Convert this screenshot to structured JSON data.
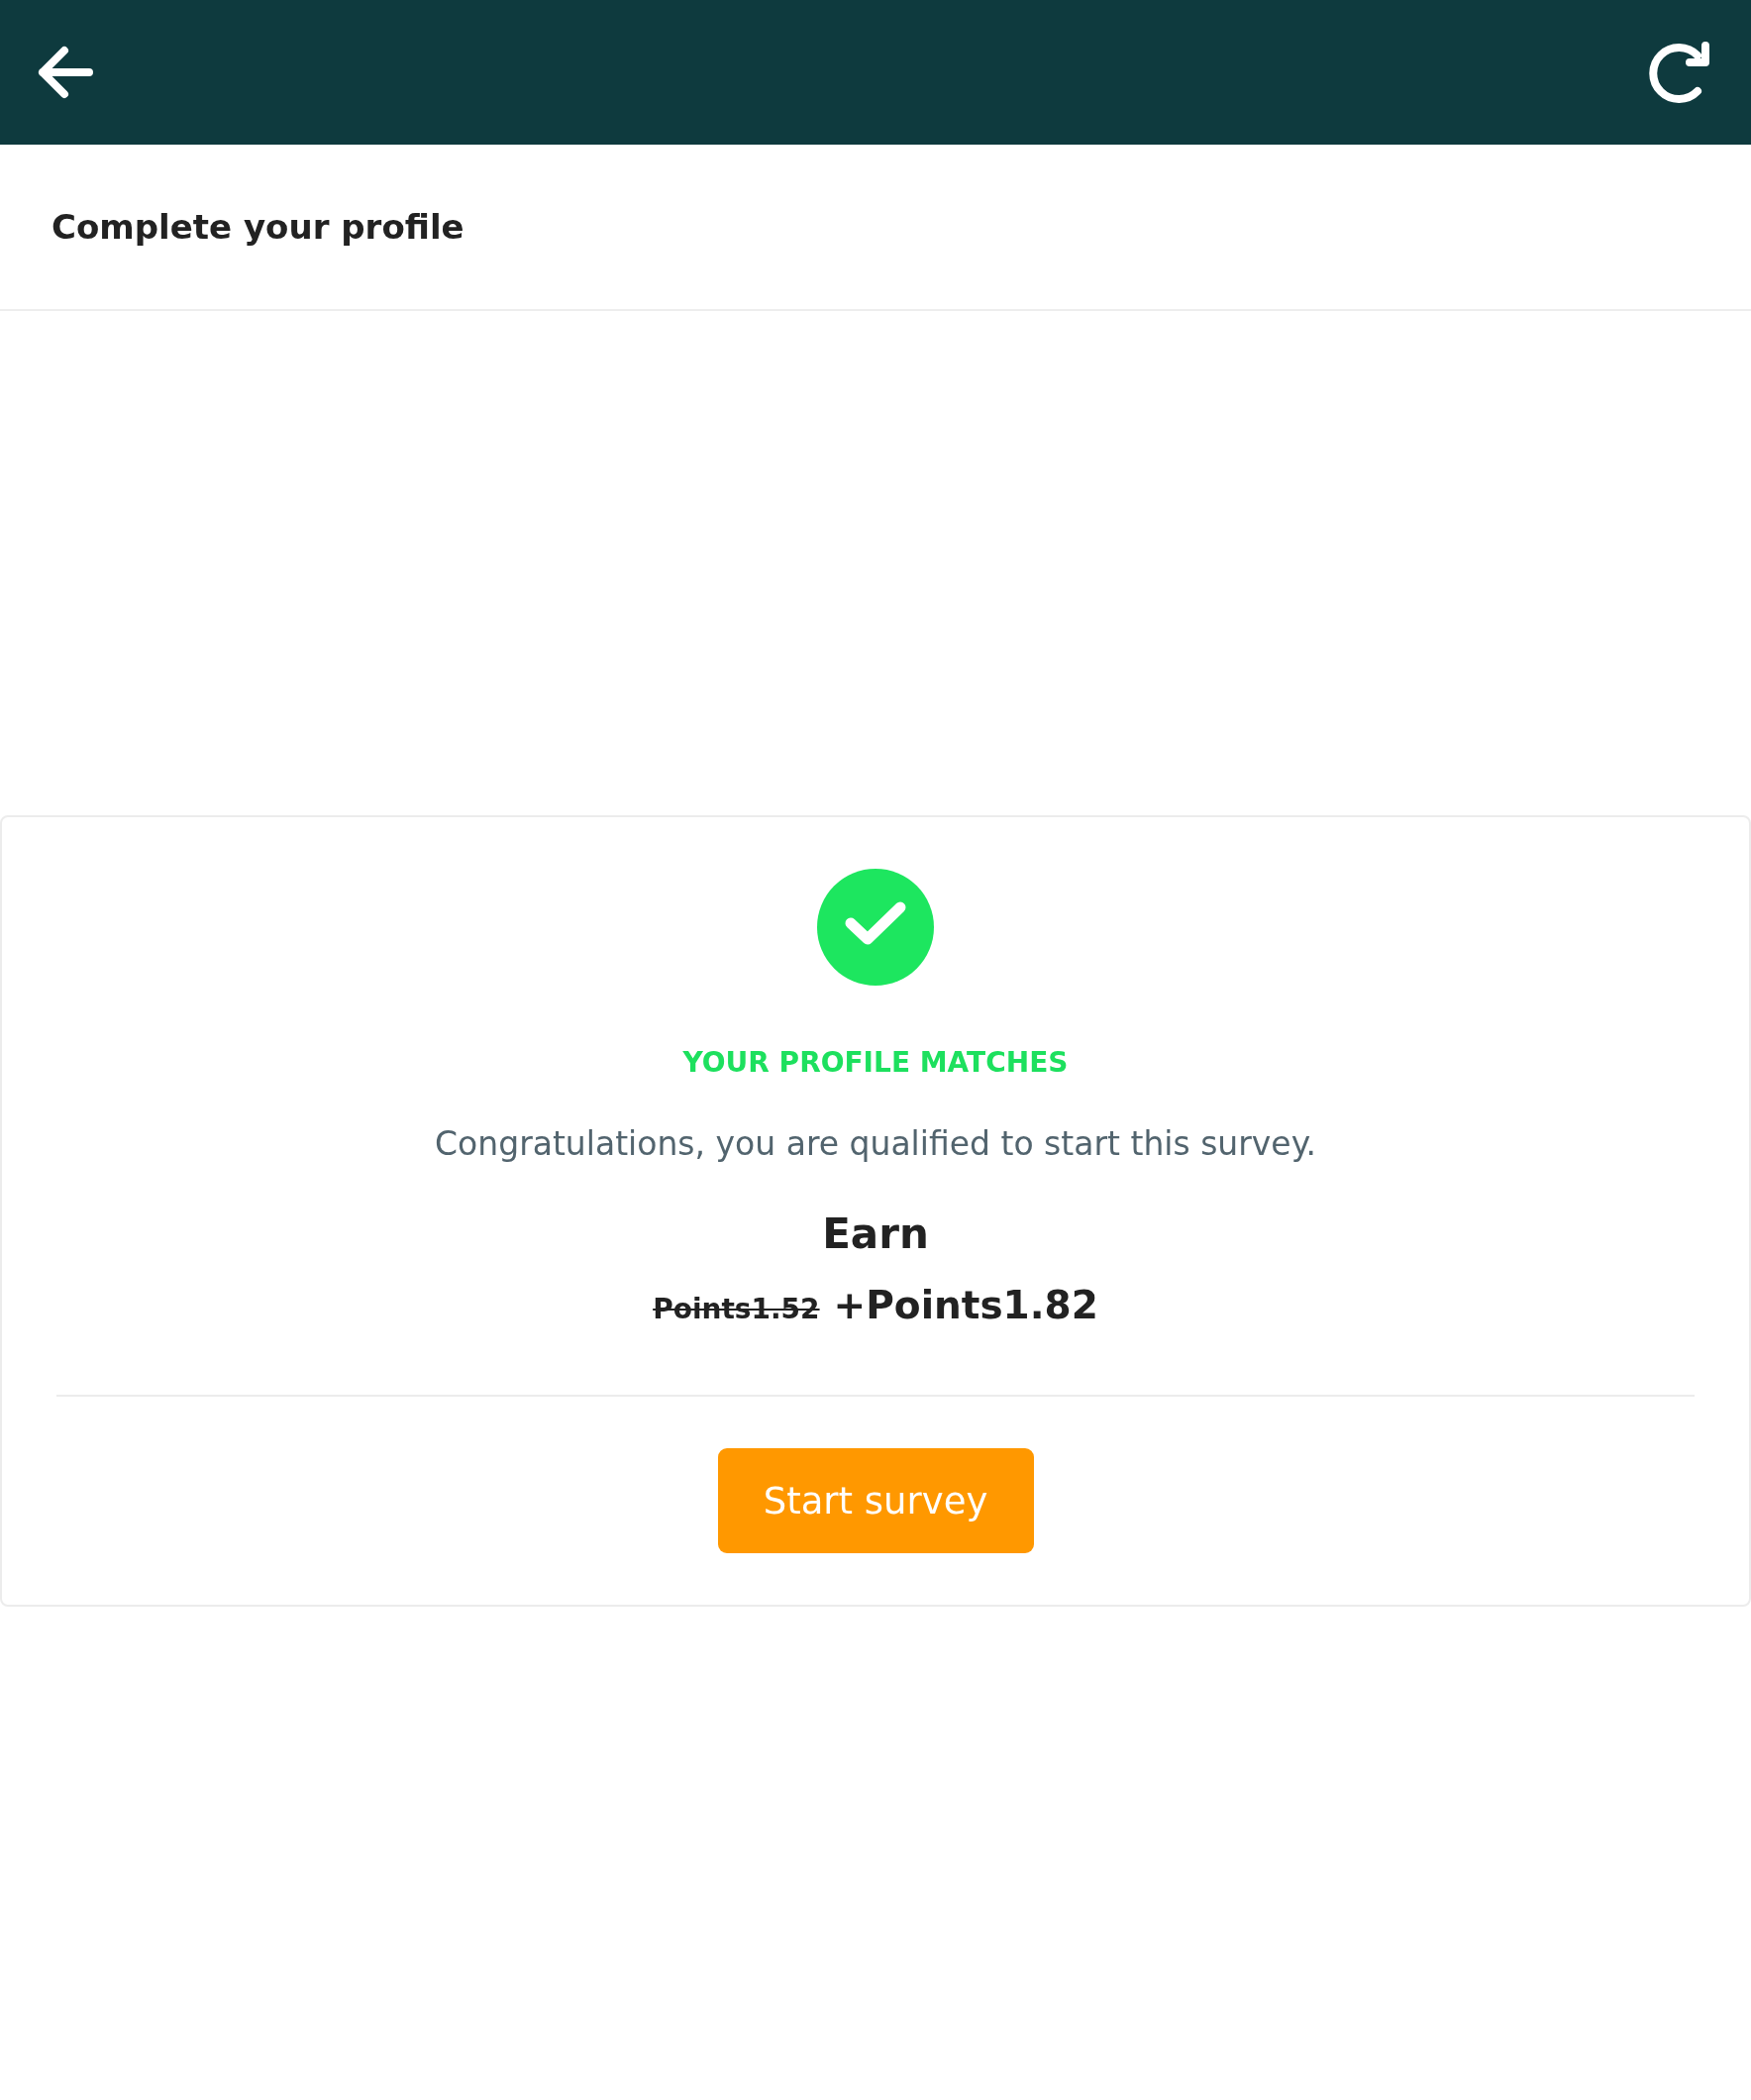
{
  "page_title": "Complete your profile",
  "match_card": {
    "status": "YOUR PROFILE MATCHES",
    "message": "Congratulations, you are qualified to start this survey.",
    "earn_label": "Earn",
    "old_reward": "Points1.52",
    "new_reward": "+Points1.82",
    "button": "Start survey"
  }
}
